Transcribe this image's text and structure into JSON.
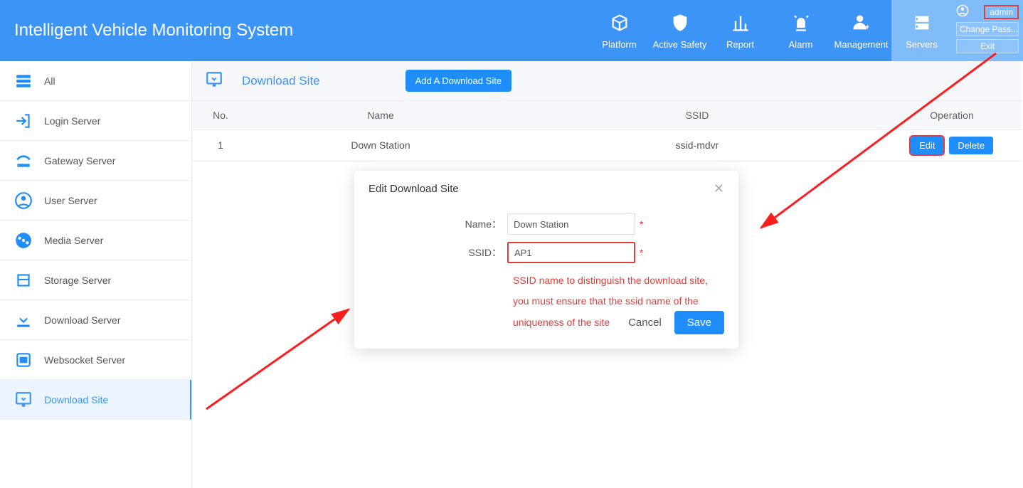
{
  "header": {
    "title": "Intelligent Vehicle Monitoring System",
    "nav": [
      {
        "label": "Platform",
        "icon": "cube"
      },
      {
        "label": "Active Safety",
        "icon": "shield"
      },
      {
        "label": "Report",
        "icon": "bars"
      },
      {
        "label": "Alarm",
        "icon": "siren"
      },
      {
        "label": "Management",
        "icon": "user-gear"
      },
      {
        "label": "Servers",
        "icon": "server",
        "active": true
      }
    ],
    "user": {
      "name": "admin",
      "change_pass": "Change Pass...",
      "exit": "Exit"
    }
  },
  "sidebar": {
    "items": [
      {
        "label": "All",
        "icon": "all"
      },
      {
        "label": "Login Server",
        "icon": "login"
      },
      {
        "label": "Gateway Server",
        "icon": "gateway"
      },
      {
        "label": "User Server",
        "icon": "user"
      },
      {
        "label": "Media Server",
        "icon": "media"
      },
      {
        "label": "Storage Server",
        "icon": "storage"
      },
      {
        "label": "Download Server",
        "icon": "download"
      },
      {
        "label": "Websocket Server",
        "icon": "websocket"
      },
      {
        "label": "Download Site",
        "icon": "download-site",
        "active": true
      }
    ]
  },
  "page": {
    "title": "Download Site",
    "add_btn": "Add A Download Site"
  },
  "table": {
    "headers": {
      "no": "No.",
      "name": "Name",
      "ssid": "SSID",
      "operation": "Operation"
    },
    "rows": [
      {
        "no": "1",
        "name": "Down Station",
        "ssid": "ssid-mdvr",
        "edit": "Edit",
        "delete": "Delete"
      }
    ]
  },
  "modal": {
    "title": "Edit Download Site",
    "fields": {
      "name_label": "Name：",
      "name_value": "Down Station",
      "ssid_label": "SSID：",
      "ssid_value": "AP1"
    },
    "help": "SSID name to distinguish the download site, you must ensure that the ssid name of the uniqueness of the site",
    "cancel": "Cancel",
    "save": "Save"
  }
}
